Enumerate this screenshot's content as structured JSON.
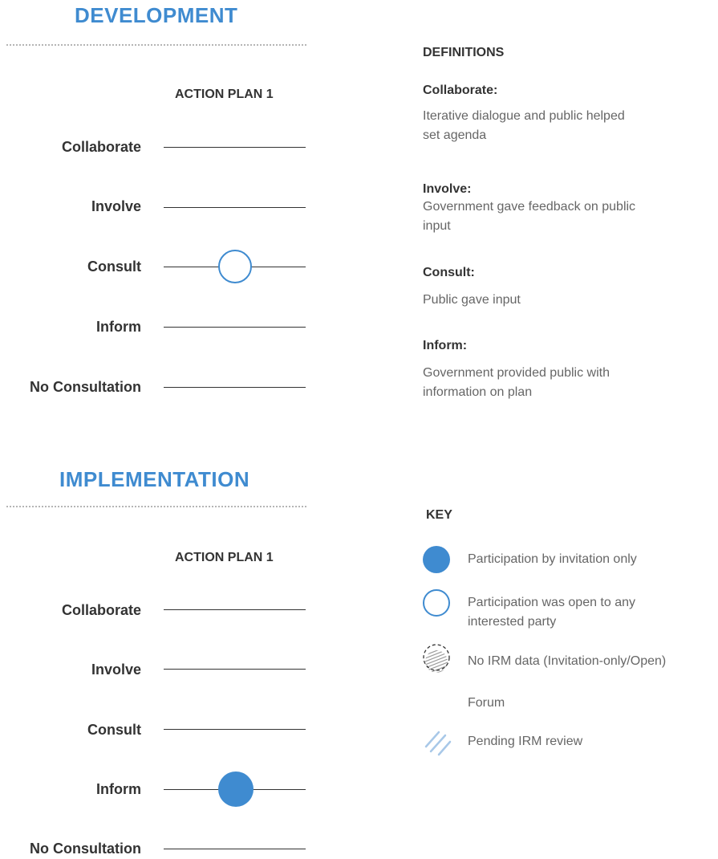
{
  "development": {
    "title": "DEVELOPMENT",
    "plan_label": "ACTION PLAN 1",
    "levels": [
      "Collaborate",
      "Involve",
      "Consult",
      "Inform",
      "No Consultation"
    ],
    "marker_level": "Consult",
    "marker_type": "open"
  },
  "implementation": {
    "title": "IMPLEMENTATION",
    "plan_label": "ACTION PLAN 1",
    "levels": [
      "Collaborate",
      "Involve",
      "Consult",
      "Inform",
      "No Consultation"
    ],
    "marker_level": "Inform",
    "marker_type": "filled"
  },
  "definitions": {
    "heading": "DEFINITIONS",
    "items": [
      {
        "term": "Collaborate:",
        "text": "Iterative dialogue and public helped set agenda"
      },
      {
        "term": "Involve:",
        "text": "Government gave feedback on public input"
      },
      {
        "term": "Consult:",
        "text": "Public gave input"
      },
      {
        "term": "Inform:",
        "text": "Government provided public with information on plan"
      }
    ]
  },
  "key": {
    "heading": "KEY",
    "items": [
      {
        "icon": "filled-circle-icon",
        "label": "Participation by invitation only"
      },
      {
        "icon": "open-circle-icon",
        "label": "Participation was open to any interested party"
      },
      {
        "icon": "hatched-circle-icon",
        "label": "No IRM data (Invitation-only/Open)"
      },
      {
        "icon": "dashed-circle-icon",
        "label": "Forum"
      },
      {
        "icon": "striped-circle-icon",
        "label": "Pending IRM review"
      }
    ]
  },
  "colors": {
    "accent": "#3f8bd0",
    "text": "#333333",
    "muted": "#666666",
    "dots": "#b5b5b5"
  }
}
